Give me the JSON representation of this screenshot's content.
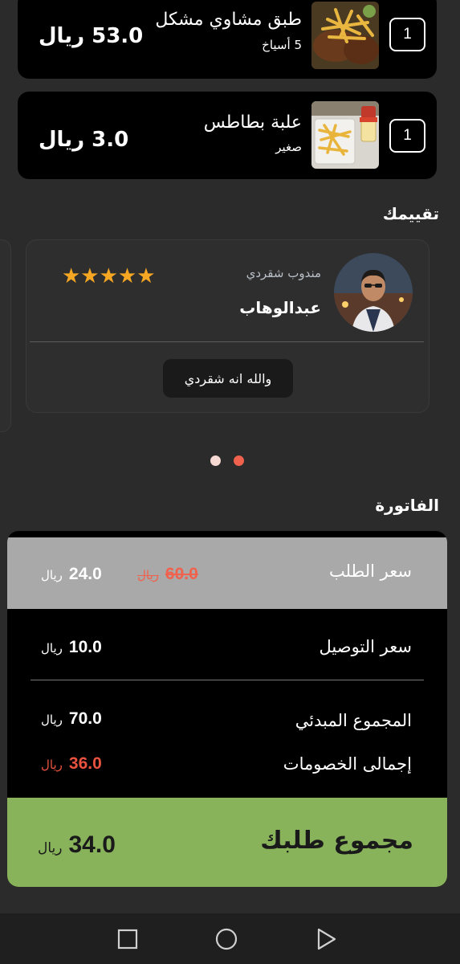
{
  "order_items": [
    {
      "qty": "1",
      "name": "طبق مشاوي مشكل",
      "sub": "5 أسياخ",
      "price": "53.0 ريال"
    },
    {
      "qty": "1",
      "name": "علبة بطاطس",
      "sub": "صغير",
      "price": "3.0 ريال"
    }
  ],
  "review": {
    "section_title": "تقييمك",
    "role": "مندوب شقردي",
    "name": "عبدالوهاب",
    "rating": 5,
    "stars": "★★★★★",
    "comment": "والله انه شقردي"
  },
  "pager": {
    "pages": 2,
    "active_index": 1
  },
  "invoice": {
    "section_title": "الفاتورة",
    "order_price": {
      "label": "سعر الطلب",
      "value": "24.0",
      "old_value": "60.0",
      "currency": "ريال"
    },
    "delivery_price": {
      "label": "سعر التوصيل",
      "value": "10.0",
      "currency": "ريال"
    },
    "subtotal": {
      "label": "المجموع المبدئي",
      "value": "70.0",
      "currency": "ريال"
    },
    "discounts": {
      "label": "إجمالى الخصومات",
      "value": "36.0",
      "currency": "ريال"
    },
    "total": {
      "label": "مجموع طلبك",
      "value": "34.0",
      "currency": "ريال"
    }
  },
  "colors": {
    "accent_orange": "#f0624d",
    "discount_red": "#e8523f",
    "total_green": "#88b35b",
    "star": "#f5a623"
  },
  "navbar": {
    "icons": [
      "recent-apps-icon",
      "home-icon",
      "back-icon"
    ]
  }
}
